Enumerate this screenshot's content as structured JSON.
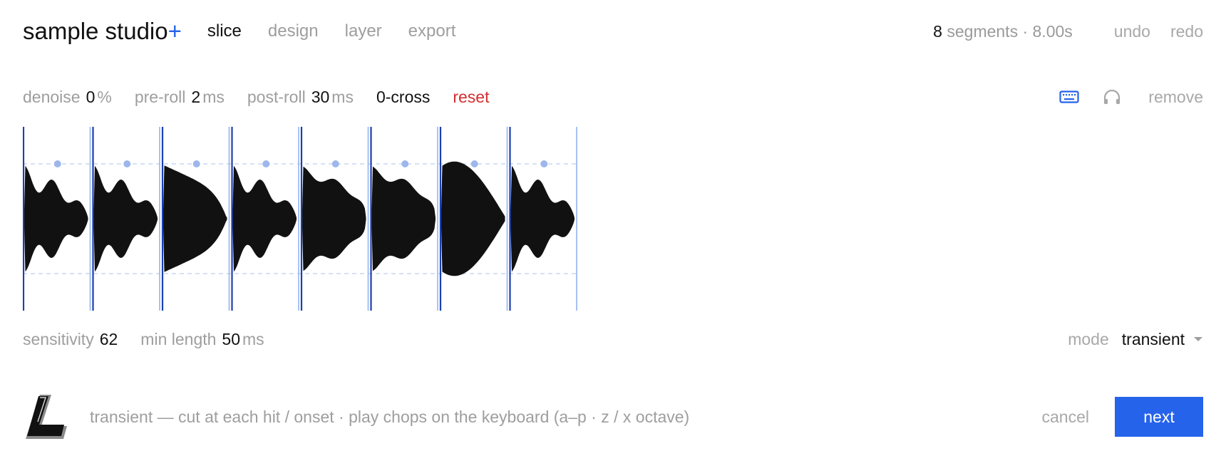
{
  "header": {
    "brand": "sample studio",
    "brand_plus": "+",
    "tabs": [
      {
        "label": "slice",
        "active": true
      },
      {
        "label": "design",
        "active": false
      },
      {
        "label": "layer",
        "active": false
      },
      {
        "label": "export",
        "active": false
      }
    ],
    "segment_count": "8",
    "segment_text": "segments · 8.00s",
    "undo": "undo",
    "redo": "redo"
  },
  "params": {
    "denoise": {
      "label": "denoise",
      "value": "0",
      "unit": "%"
    },
    "pre_roll": {
      "label": "pre-roll",
      "value": "2",
      "unit": "ms"
    },
    "post_roll": {
      "label": "post-roll",
      "value": "30",
      "unit": "ms"
    },
    "zero_cross": "0-cross",
    "reset": "reset",
    "keyboard_icon": "keyboard-icon",
    "headphones_icon": "headphones-icon",
    "remove": "remove"
  },
  "waveform": {
    "segment_count": 8,
    "segments": [
      {
        "shape": "bumpy"
      },
      {
        "shape": "bumpy"
      },
      {
        "shape": "ramp"
      },
      {
        "shape": "bumpy"
      },
      {
        "shape": "plateau"
      },
      {
        "shape": "plateau"
      },
      {
        "shape": "dome"
      },
      {
        "shape": "bumpy"
      }
    ],
    "colors": {
      "marker": "#1e40af",
      "boundary": "#93b4f0",
      "guide": "#c7d7f2",
      "handle": "#9db7ec",
      "fill": "#111111"
    }
  },
  "detect": {
    "sensitivity": {
      "label": "sensitivity",
      "value": "62"
    },
    "min_length": {
      "label": "min length",
      "value": "50",
      "unit": "ms"
    },
    "mode_label": "mode",
    "mode_value": "transient"
  },
  "footer": {
    "hint": "transient — cut at each hit / onset · play chops on the keyboard (a–p · z / x octave)",
    "cancel": "cancel",
    "next": "next"
  },
  "colors": {
    "accent": "#2563eb",
    "danger": "#d32f2f",
    "muted": "#9e9e9e"
  }
}
